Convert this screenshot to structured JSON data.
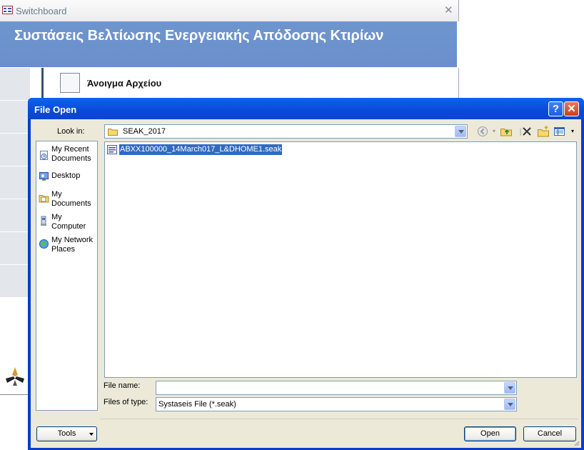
{
  "switchboard": {
    "window_title": "Switchboard",
    "header_title": "Συστάσεις Βελτίωσης Ενεργειακής Απόδοσης Κτιρίων",
    "button_label": "Άνοιγμα Αρχείου"
  },
  "dialog": {
    "title": "File Open",
    "look_in_label": "Look in:",
    "look_in_value": "SEAK_2017",
    "places": [
      {
        "label": "My Recent Documents",
        "icon": "recent-documents-icon"
      },
      {
        "label": "Desktop",
        "icon": "desktop-icon"
      },
      {
        "label": "My Documents",
        "icon": "my-documents-icon"
      },
      {
        "label": "My Computer",
        "icon": "my-computer-icon"
      },
      {
        "label": "My Network Places",
        "icon": "network-places-icon"
      }
    ],
    "files": [
      {
        "name": "ABXX100000_14March017_L&DHOME1.seak",
        "selected": true
      }
    ],
    "file_name_label": "File name:",
    "file_name_value": "",
    "file_type_label": "Files of type:",
    "file_type_value": "Systaseis File (*.seak)",
    "tools_label": "Tools",
    "open_label": "Open",
    "cancel_label": "Cancel",
    "help_label": "?"
  },
  "colors": {
    "title_bar": "#0a4ad8",
    "header_band": "#6f95cf",
    "selection": "#316ac5",
    "dialog_body": "#ece9d8"
  }
}
